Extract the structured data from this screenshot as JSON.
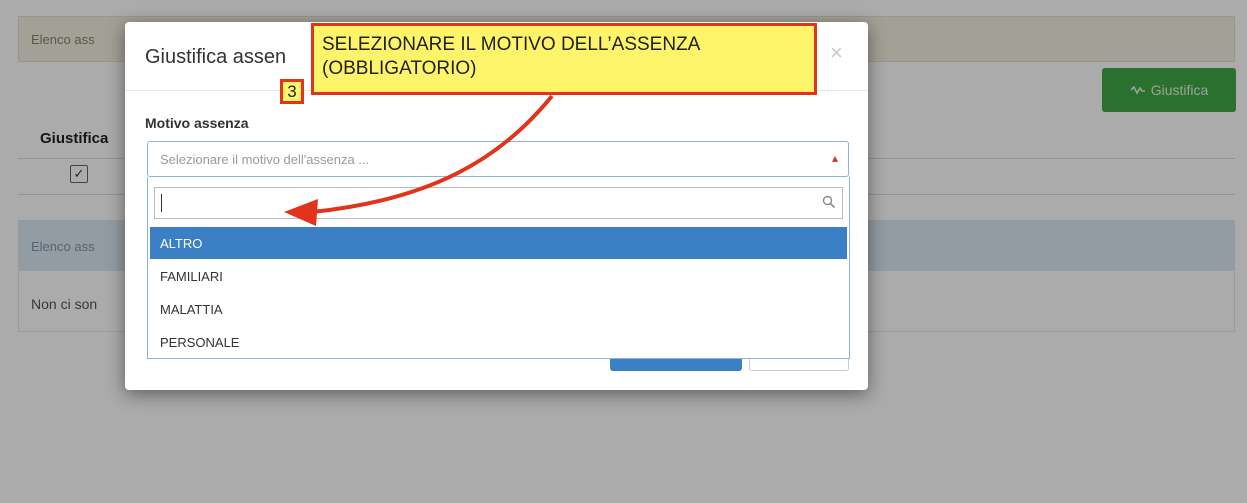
{
  "background": {
    "panel1_header": "Elenco ass",
    "justify_button_label": "Giustifica",
    "justify_column_header": "Giustifica",
    "justify_checkbox_mark": "✓",
    "panel2_header": "Elenco ass",
    "panel2_body": "Non ci son"
  },
  "modal": {
    "title": "Giustifica assen",
    "close_glyph": "×",
    "field_label": "Motivo assenza",
    "select_placeholder": "Selezionare il motivo dell'assenza ...",
    "options": [
      "ALTRO",
      "FAMILIARI",
      "MALATTIA",
      "PERSONALE"
    ],
    "selected_option": "ALTRO"
  },
  "annotation": {
    "callout_line1": "SELEZIONARE IL MOTIVO DELL’ASSENZA",
    "callout_line2": "(OBBLIGATORIO)",
    "step_number": "3"
  },
  "colors": {
    "success_button": "#3fa845",
    "highlight": "#3b7fc4",
    "annotation_fill": "#fef46a",
    "annotation_border": "#e2331c"
  },
  "icons": {
    "justify_button_icon": "signature-icon",
    "search_icon": "search-icon",
    "dropdown_arrow": "caret-icon"
  }
}
